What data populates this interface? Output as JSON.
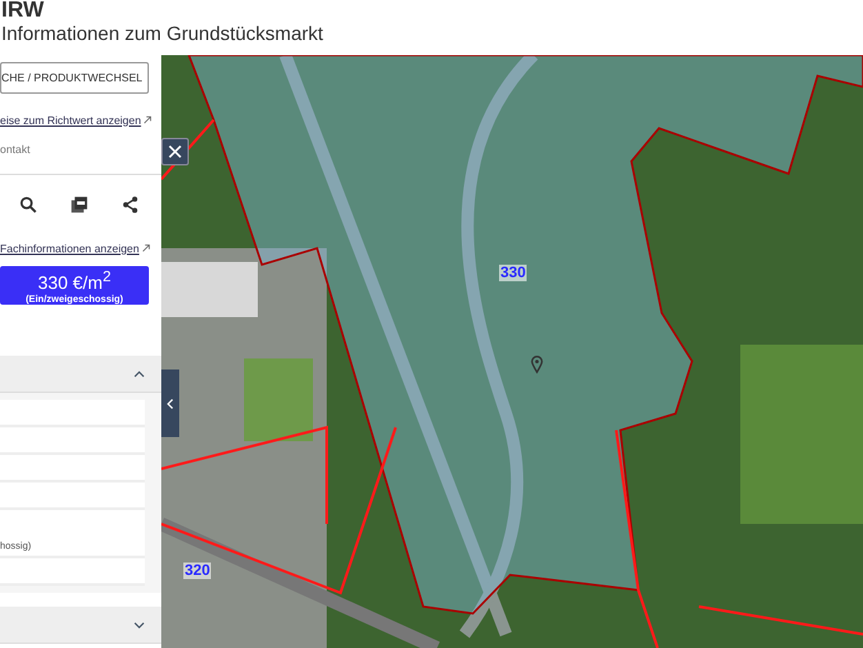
{
  "header": {
    "title": "IRW",
    "subtitle": "Informationen zum Grundstücksmarkt"
  },
  "panel": {
    "switch_button": "CHE / PRODUKTWECHSEL",
    "hint_link": "eise zum Richtwert anzeigen",
    "contact": "ontakt",
    "info_link": "Fachinformationen anzeigen",
    "value_card": {
      "price": "330 €/m$^{2}$",
      "note": "(Ein/zweigeschossig)"
    },
    "sections": [
      {
        "expanded": true,
        "rows": [
          {},
          {},
          {},
          {},
          {
            "text": "hossig)"
          },
          {}
        ]
      },
      {
        "expanded": false
      }
    ]
  },
  "map": {
    "zones": [
      {
        "label": "330"
      },
      {
        "label": "320"
      }
    ]
  }
}
